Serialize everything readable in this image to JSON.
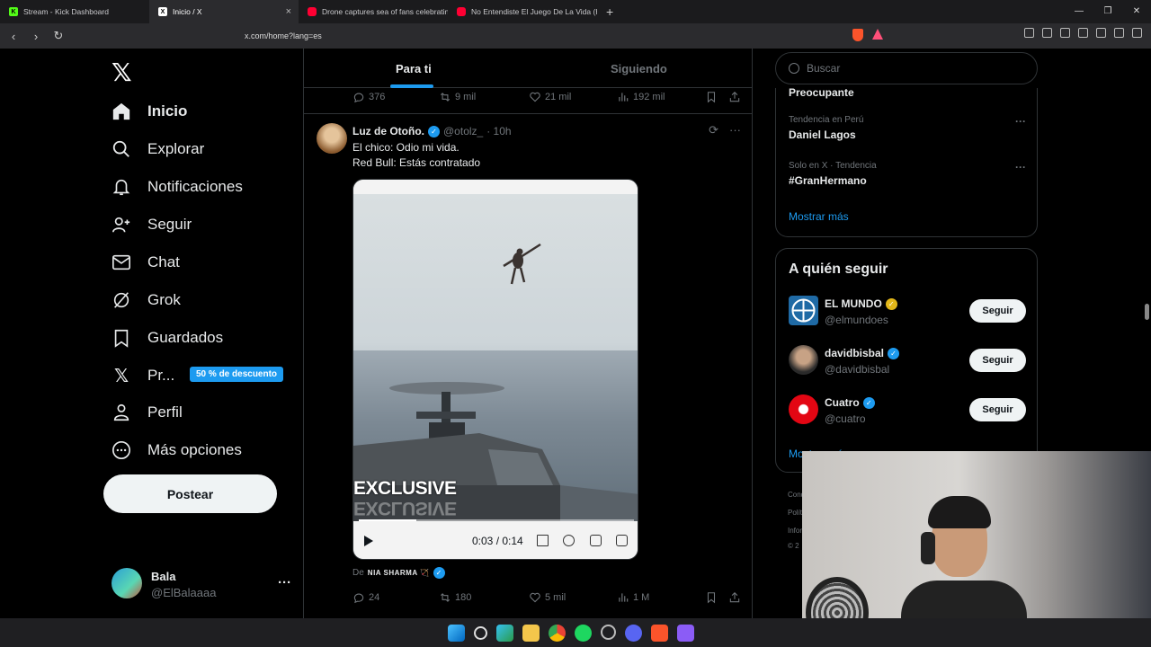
{
  "browser": {
    "tabs": [
      {
        "title": "Stream - Kick Dashboard",
        "icon": "kick-icon",
        "color": "#53fc18"
      },
      {
        "title": "Inicio / X",
        "icon": "x-icon",
        "color": "#ffffff"
      },
      {
        "title": "Drone captures sea of fans celebratin",
        "icon": "youtube-icon",
        "color": "#ff0033"
      },
      {
        "title": "No Entendiste El Juego De La Vida (H",
        "icon": "youtube-icon",
        "color": "#ff0033"
      }
    ],
    "new_tab": "+",
    "url": "x.com/home?lang=es"
  },
  "nav": {
    "logo": "𝕏",
    "items": [
      {
        "label": "Inicio",
        "icon": "home-icon"
      },
      {
        "label": "Explorar",
        "icon": "search-icon"
      },
      {
        "label": "Notificaciones",
        "icon": "bell-icon"
      },
      {
        "label": "Seguir",
        "icon": "follow-icon"
      },
      {
        "label": "Chat",
        "icon": "mail-icon"
      },
      {
        "label": "Grok",
        "icon": "grok-icon"
      },
      {
        "label": "Guardados",
        "icon": "bookmark-icon"
      },
      {
        "label": "Pr...",
        "icon": "x-premium-icon"
      },
      {
        "label": "Perfil",
        "icon": "person-icon"
      },
      {
        "label": "Más opciones",
        "icon": "more-icon"
      }
    ],
    "promo_badge": "50 % de descuento",
    "post_button": "Postear",
    "user": {
      "name": "Bala",
      "handle": "@ElBalaaaa",
      "more": "···"
    }
  },
  "feed": {
    "tabs": [
      "Para ti",
      "Siguiendo"
    ],
    "prev_tweet_stats": {
      "replies": "376",
      "reposts": "9 mil",
      "likes": "21 mil",
      "views": "192 mil"
    },
    "tweet": {
      "name": "Luz de Otoño.",
      "handle": "@otolz_",
      "time": "· 10h",
      "text_line1": "El chico: Odio mi vida.",
      "text_line2": "Red Bull: Estás contratado",
      "video": {
        "overlay_text": "EXCLUSIVE",
        "time": "0:03 / 0:14",
        "progress": 0.21
      },
      "from_prefix": "De",
      "from_name": "NIA SHARMA 🏹",
      "stats": {
        "replies": "24",
        "reposts": "180",
        "likes": "5 mil",
        "views": "1 M"
      }
    }
  },
  "sidebar": {
    "search_placeholder": "Buscar",
    "trends": [
      {
        "context": "",
        "name": "Preocupante"
      },
      {
        "context": "Tendencia en Perú",
        "name": "Daniel Lagos"
      },
      {
        "context": "Solo en X · Tendencia",
        "name": "#GranHermano"
      }
    ],
    "show_more": "Mostrar más",
    "who_to_follow_title": "A quién seguir",
    "follow": [
      {
        "name": "EL MUNDO",
        "handle": "@elmundoes",
        "badge": "gold",
        "button": "Seguir"
      },
      {
        "name": "davidbisbal",
        "handle": "@davidbisbal",
        "badge": "blue",
        "button": "Seguir"
      },
      {
        "name": "Cuatro",
        "handle": "@cuatro",
        "badge": "blue",
        "button": "Seguir"
      }
    ],
    "follow_show_more": "Mostrar más",
    "footer": [
      "Cond",
      "Polít",
      "Infor",
      "© 2"
    ]
  }
}
